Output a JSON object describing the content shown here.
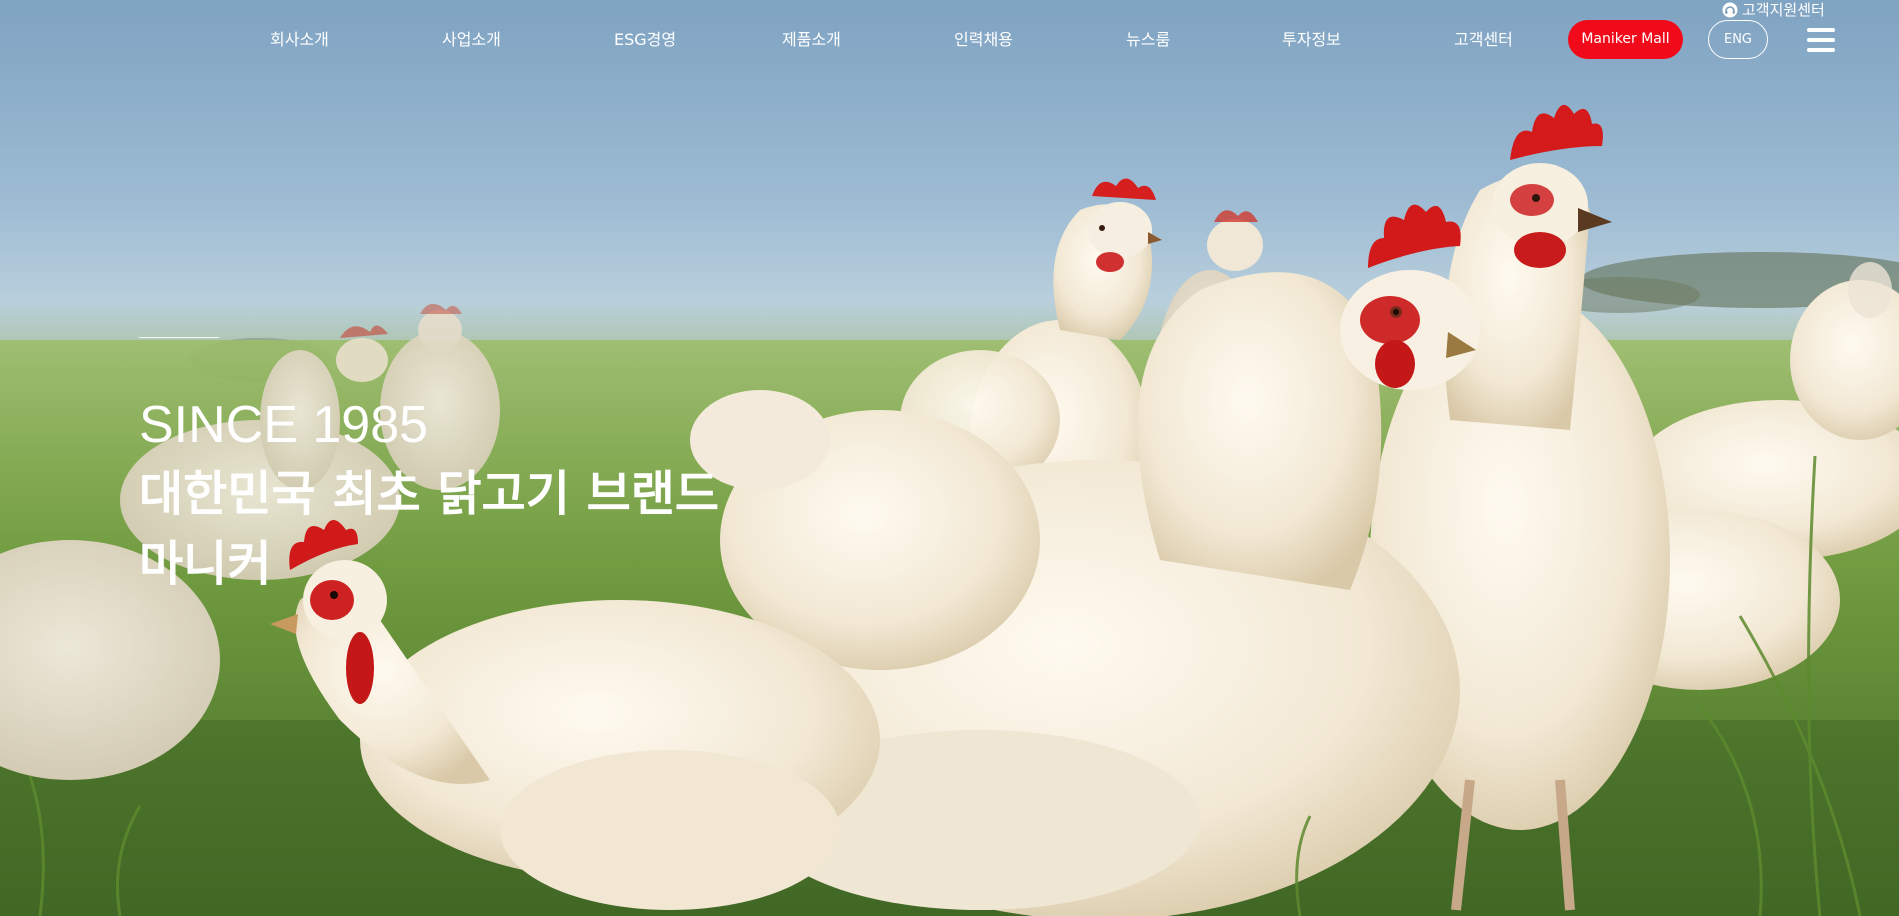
{
  "nav": {
    "items": [
      {
        "label": "회사소개"
      },
      {
        "label": "사업소개"
      },
      {
        "label": "ESG경영"
      },
      {
        "label": "제품소개"
      },
      {
        "label": "인력채용"
      },
      {
        "label": "뉴스룸"
      },
      {
        "label": "투자정보"
      },
      {
        "label": "고객센터"
      }
    ],
    "mall_label": "Maniker Mall",
    "lang_label": "ENG",
    "menu_icon": "hamburger-menu-icon",
    "support_label": "고객지원센터",
    "support_icon": "headset-icon"
  },
  "hero": {
    "since": "SINCE 1985",
    "title_line1": "대한민국 최초 닭고기 브랜드",
    "title_line2": "마니커"
  },
  "colors": {
    "accent_red": "#f10a1a",
    "text_white": "#ffffff",
    "sky": "#8eb0cb",
    "grass": "#6f9a42",
    "feather": "#f4ecda",
    "comb": "#d81e1e"
  }
}
